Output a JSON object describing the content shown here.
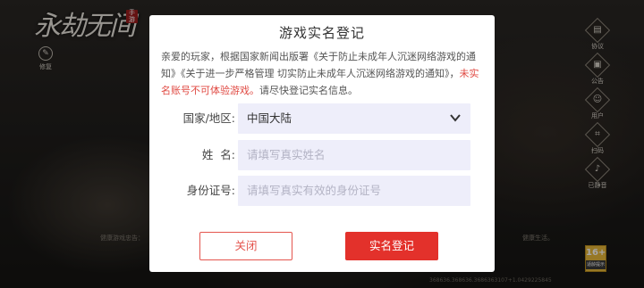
{
  "background": {
    "logo": "永劫无间",
    "logo_badge": "手游",
    "repair_label": "修复",
    "side_menu": [
      {
        "label": "协议",
        "icon": "document-icon",
        "glyph": "▤"
      },
      {
        "label": "公告",
        "icon": "announcement-icon",
        "glyph": "▣"
      },
      {
        "label": "用户",
        "icon": "user-icon",
        "glyph": "☺"
      },
      {
        "label": "扫码",
        "icon": "scan-icon",
        "glyph": "⌗"
      },
      {
        "label": "已静音",
        "icon": "mute-icon",
        "glyph": "♪"
      }
    ],
    "health_notice_left": "健康游戏忠告：",
    "health_notice_right": "健康生活。",
    "version": "368636.368636.3686363107+1.0429225845",
    "age_rating": {
      "number": "16+",
      "caption": "适龄提示"
    }
  },
  "dialog": {
    "title": "游戏实名登记",
    "notice_text": "亲爱的玩家，根据国家新闻出版署《关于防止未成年人沉迷网络游戏的通知》《关于进一步严格管理 切实防止未成年人沉迷网络游戏的通知》，",
    "notice_warning": "未实名账号不可体验游戏。",
    "notice_tail": "请尽快登记实名信息。",
    "region": {
      "label": "国家/地区:",
      "value": "中国大陆"
    },
    "name": {
      "label": "姓  名:",
      "placeholder": "请填写真实姓名"
    },
    "id_number": {
      "label": "身份证号:",
      "placeholder": "请填写真实有效的身份证号"
    },
    "buttons": {
      "close": "关闭",
      "submit": "实名登记"
    },
    "colors": {
      "accent": "#e3312b",
      "field_bg": "#eeeefa",
      "warning_text": "#e04a43"
    }
  }
}
